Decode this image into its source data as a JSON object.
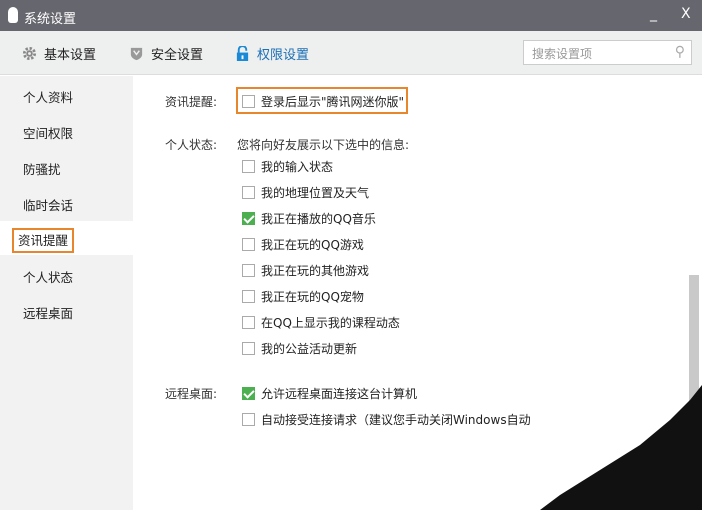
{
  "window": {
    "title": "系统设置",
    "minimize": "_",
    "close": "X"
  },
  "toolbar": {
    "tabs": [
      {
        "label": "基本设置",
        "icon": "gear-icon"
      },
      {
        "label": "安全设置",
        "icon": "shield-icon"
      },
      {
        "label": "权限设置",
        "icon": "lock-icon",
        "active": true
      }
    ],
    "search_placeholder": "搜索设置项"
  },
  "sidebar": {
    "items": [
      "个人资料",
      "空间权限",
      "防骚扰",
      "临时会话",
      "资讯提醒",
      "个人状态",
      "远程桌面"
    ],
    "selected": "资讯提醒"
  },
  "content": {
    "news": {
      "label": "资讯提醒:",
      "option": "登录后显示\"腾讯网迷你版\"",
      "checked": false
    },
    "status": {
      "label": "个人状态:",
      "desc": "您将向好友展示以下选中的信息:",
      "options": [
        {
          "text": "我的输入状态",
          "checked": false
        },
        {
          "text": "我的地理位置及天气",
          "checked": false
        },
        {
          "text": "我正在播放的QQ音乐",
          "checked": true
        },
        {
          "text": "我正在玩的QQ游戏",
          "checked": false
        },
        {
          "text": "我正在玩的其他游戏",
          "checked": false
        },
        {
          "text": "我正在玩的QQ宠物",
          "checked": false
        },
        {
          "text": "在QQ上显示我的课程动态",
          "checked": false
        },
        {
          "text": "我的公益活动更新",
          "checked": false
        }
      ]
    },
    "remote": {
      "label": "远程桌面:",
      "options": [
        {
          "text": "允许远程桌面连接这台计算机",
          "checked": true
        },
        {
          "text": "自动接受连接请求（建议您手动关闭Windows自动",
          "checked": false
        }
      ]
    }
  },
  "colors": {
    "titlebar": "#66666f",
    "accent": "#e8862e",
    "active_tab": "#1a6fb5",
    "check": "#4caf50"
  }
}
